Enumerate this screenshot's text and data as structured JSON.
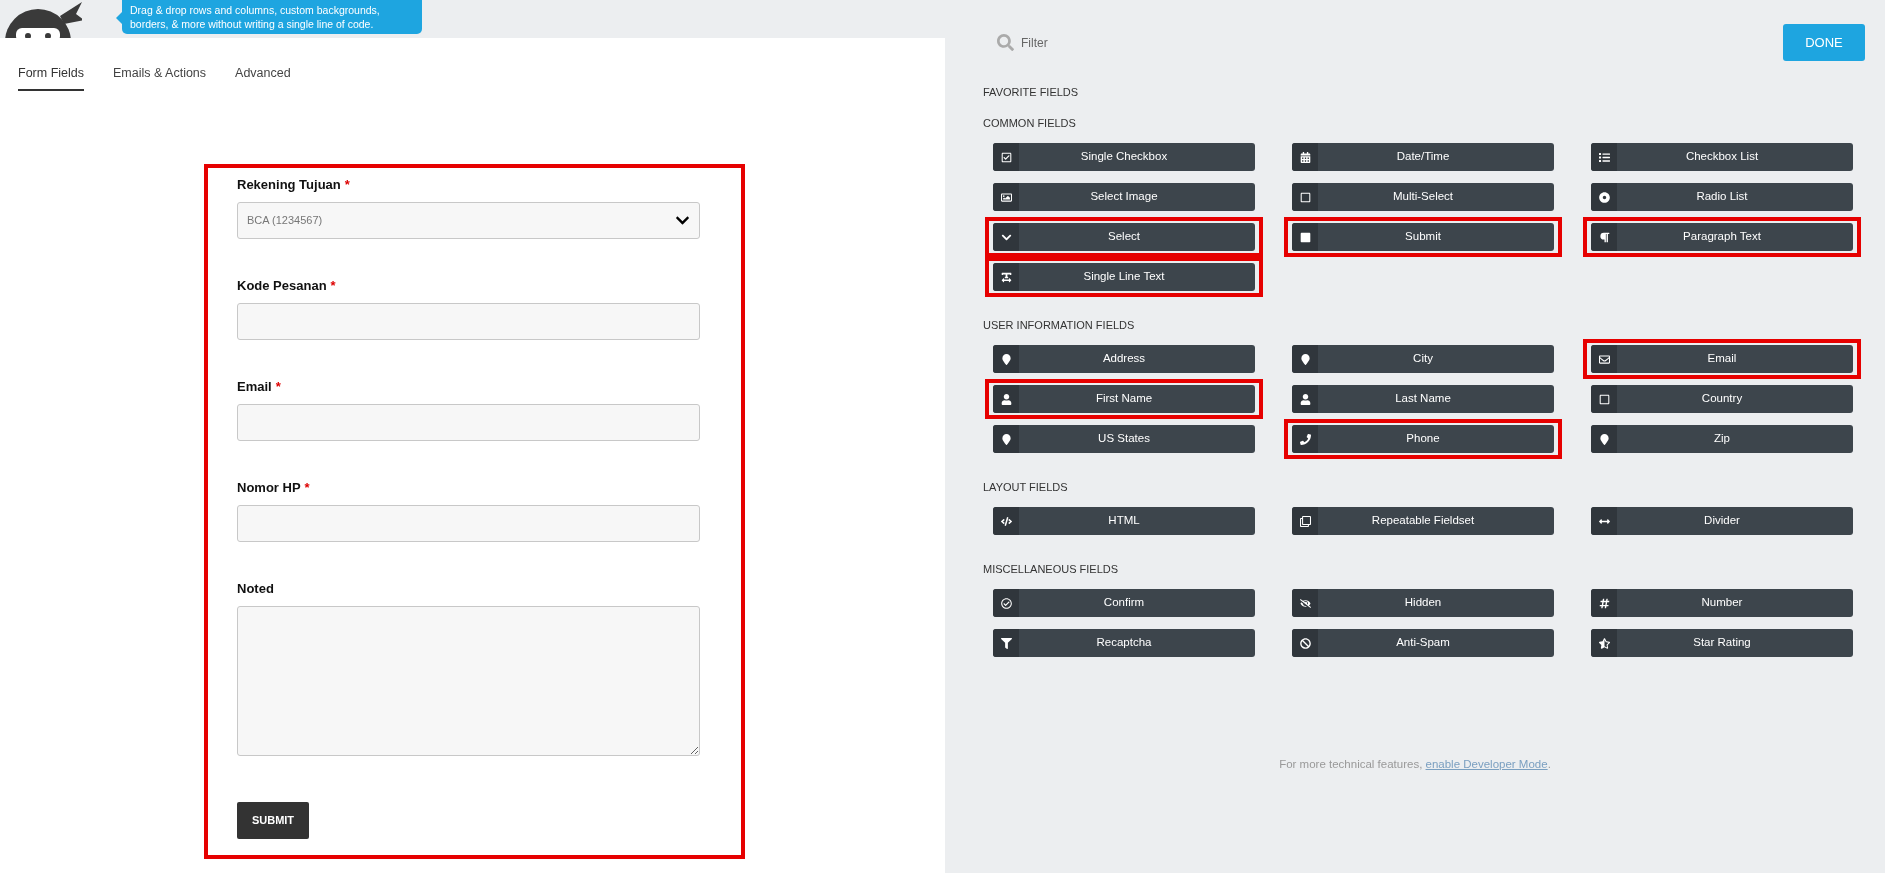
{
  "header": {
    "tooltip": "Drag & drop rows and columns, custom backgrounds, borders, & more without writing a single line of code."
  },
  "tabs": [
    {
      "label": "Form Fields",
      "selected": true
    },
    {
      "label": "Emails & Actions",
      "selected": false
    },
    {
      "label": "Advanced",
      "selected": false
    }
  ],
  "form": {
    "highlighted": true,
    "fields": [
      {
        "kind": "select",
        "label": "Rekening Tujuan",
        "required_mark": "*",
        "value": "BCA (1234567)"
      },
      {
        "kind": "text",
        "label": "Kode Pesanan",
        "required_mark": "*"
      },
      {
        "kind": "text",
        "label": "Email",
        "required_mark": "*"
      },
      {
        "kind": "text",
        "label": "Nomor HP",
        "required_mark": "*"
      },
      {
        "kind": "textarea",
        "label": "Noted"
      }
    ],
    "submit": "SUBMIT"
  },
  "filter": {
    "placeholder": "Filter"
  },
  "done_button": "DONE",
  "sections": [
    {
      "title": "FAVORITE FIELDS"
    },
    {
      "title": "COMMON FIELDS",
      "fields": [
        {
          "label": "Single Checkbox",
          "highlighted": false
        },
        {
          "label": "Date/Time",
          "highlighted": false
        },
        {
          "label": "Checkbox List",
          "highlighted": false
        },
        {
          "label": "Select Image",
          "highlighted": false
        },
        {
          "label": "Multi-Select",
          "highlighted": false
        },
        {
          "label": "Radio List",
          "highlighted": false
        },
        {
          "label": "Select",
          "highlighted": true
        },
        {
          "label": "Submit",
          "highlighted": true
        },
        {
          "label": "Paragraph Text",
          "highlighted": true
        },
        {
          "label": "Single Line Text",
          "highlighted": true
        }
      ]
    },
    {
      "title": "USER INFORMATION FIELDS",
      "fields": [
        {
          "label": "Address",
          "highlighted": false
        },
        {
          "label": "City",
          "highlighted": false
        },
        {
          "label": "Email",
          "highlighted": true
        },
        {
          "label": "First Name",
          "highlighted": true
        },
        {
          "label": "Last Name",
          "highlighted": false
        },
        {
          "label": "Country",
          "highlighted": false
        },
        {
          "label": "US States",
          "highlighted": false
        },
        {
          "label": "Phone",
          "highlighted": true
        },
        {
          "label": "Zip",
          "highlighted": false
        }
      ]
    },
    {
      "title": "LAYOUT FIELDS",
      "fields": [
        {
          "label": "HTML",
          "highlighted": false
        },
        {
          "label": "Repeatable Fieldset",
          "highlighted": false
        },
        {
          "label": "Divider",
          "highlighted": false
        }
      ]
    },
    {
      "title": "MISCELLANEOUS FIELDS",
      "fields": [
        {
          "label": "Confirm",
          "highlighted": false
        },
        {
          "label": "Hidden",
          "highlighted": false
        },
        {
          "label": "Number",
          "highlighted": false
        },
        {
          "label": "Recaptcha",
          "highlighted": false
        },
        {
          "label": "Anti-Spam",
          "highlighted": false
        },
        {
          "label": "Star Rating",
          "highlighted": false
        }
      ]
    }
  ],
  "footer": {
    "text": "For more technical features,",
    "link": "enable Developer Mode",
    "end": "."
  }
}
